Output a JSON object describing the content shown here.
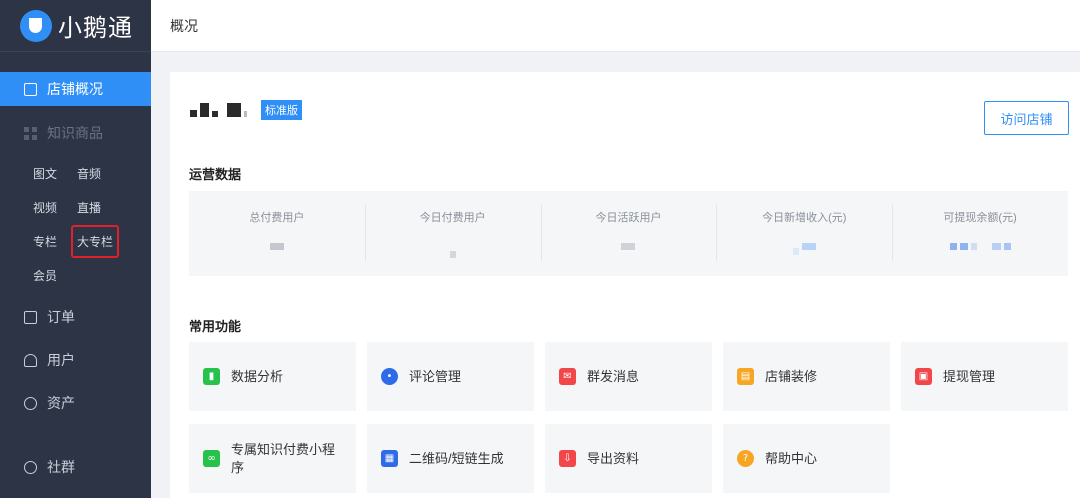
{
  "app": {
    "logo_text": "小鹅通"
  },
  "topbar": {
    "title": "概况"
  },
  "sidebar": {
    "items": [
      {
        "label": "店铺概况",
        "icon": "chart-icon",
        "active": true
      },
      {
        "label": "知识商品",
        "icon": "grid-icon",
        "disabled": true
      }
    ],
    "sub_rows": [
      [
        "图文",
        "音频"
      ],
      [
        "视频",
        "直播"
      ],
      [
        "专栏",
        "大专栏"
      ],
      [
        "会员"
      ]
    ],
    "bottom_items": [
      {
        "label": "订单",
        "icon": "document-icon"
      },
      {
        "label": "用户",
        "icon": "user-icon"
      },
      {
        "label": "资产",
        "icon": "yuan-icon"
      },
      {
        "label": "社群",
        "icon": "community-icon"
      }
    ]
  },
  "shop": {
    "version_tag": "标准版",
    "visit_button": "访问店铺"
  },
  "operations": {
    "title": "运营数据",
    "stats": [
      {
        "label": "总付费用户"
      },
      {
        "label": "今日付费用户"
      },
      {
        "label": "今日活跃用户"
      },
      {
        "label": "今日新增收入(元)"
      },
      {
        "label": "可提现余额(元)"
      }
    ]
  },
  "functions": {
    "title": "常用功能",
    "tiles": [
      {
        "label": "数据分析",
        "icon": "chart-bar-icon",
        "color": "#27c24c"
      },
      {
        "label": "评论管理",
        "icon": "comment-icon",
        "color": "#2f6be8"
      },
      {
        "label": "群发消息",
        "icon": "mail-icon",
        "color": "#f2474a"
      },
      {
        "label": "店铺装修",
        "icon": "store-icon",
        "color": "#f6a623"
      },
      {
        "label": "提现管理",
        "icon": "withdraw-icon",
        "color": "#f2474a"
      },
      {
        "label": "专属知识付费小程序",
        "icon": "miniprogram-icon",
        "color": "#27c24c"
      },
      {
        "label": "二维码/短链生成",
        "icon": "qrcode-icon",
        "color": "#2f6be8"
      },
      {
        "label": "导出资料",
        "icon": "export-icon",
        "color": "#f2474a"
      },
      {
        "label": "帮助中心",
        "icon": "help-icon",
        "color": "#f6a623"
      }
    ]
  }
}
